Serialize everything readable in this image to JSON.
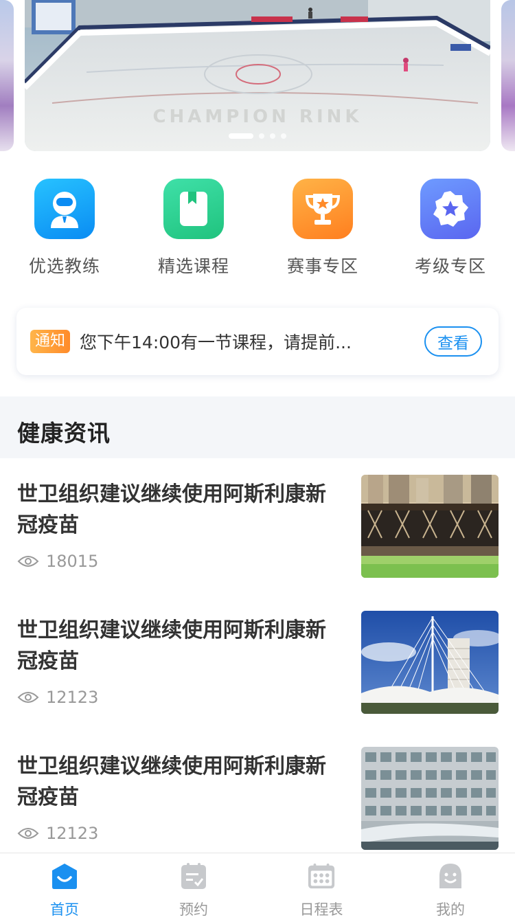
{
  "banner": {
    "sign_text": "CHAMPION RINK",
    "slide_count": 4,
    "active_slide": 0
  },
  "entries": [
    {
      "label": "优选教练",
      "icon": "coach-icon",
      "color": "#0a8cf3"
    },
    {
      "label": "精选课程",
      "icon": "course-book-icon",
      "color": "#20c37e"
    },
    {
      "label": "赛事专区",
      "icon": "trophy-icon",
      "color": "#ff7f1f"
    },
    {
      "label": "考级专区",
      "icon": "star-badge-icon",
      "color": "#5a66f0"
    }
  ],
  "notice": {
    "tag": "通知",
    "text": "您下午14:00有一节课程，请提前...",
    "button": "查看"
  },
  "section": {
    "title": "健康资讯"
  },
  "news": [
    {
      "title": "世卫组织建议继续使用阿斯利康新冠疫苗",
      "views": "18015",
      "image": "bridge-river-photo"
    },
    {
      "title": "世卫组织建议继续使用阿斯利康新冠疫苗",
      "views": "12123",
      "image": "museum-sails-photo"
    },
    {
      "title": "世卫组织建议继续使用阿斯利康新冠疫苗",
      "views": "12123",
      "image": "office-building-photo"
    }
  ],
  "tabbar": [
    {
      "label": "首页",
      "icon": "home-icon",
      "active": true
    },
    {
      "label": "预约",
      "icon": "booking-icon",
      "active": false
    },
    {
      "label": "日程表",
      "icon": "calendar-icon",
      "active": false
    },
    {
      "label": "我的",
      "icon": "profile-icon",
      "active": false
    }
  ],
  "colors": {
    "accent": "#1a90f0",
    "notice_tag": "#ff8b2a",
    "section_bg": "#f4f6f9",
    "muted_text": "#999999"
  }
}
